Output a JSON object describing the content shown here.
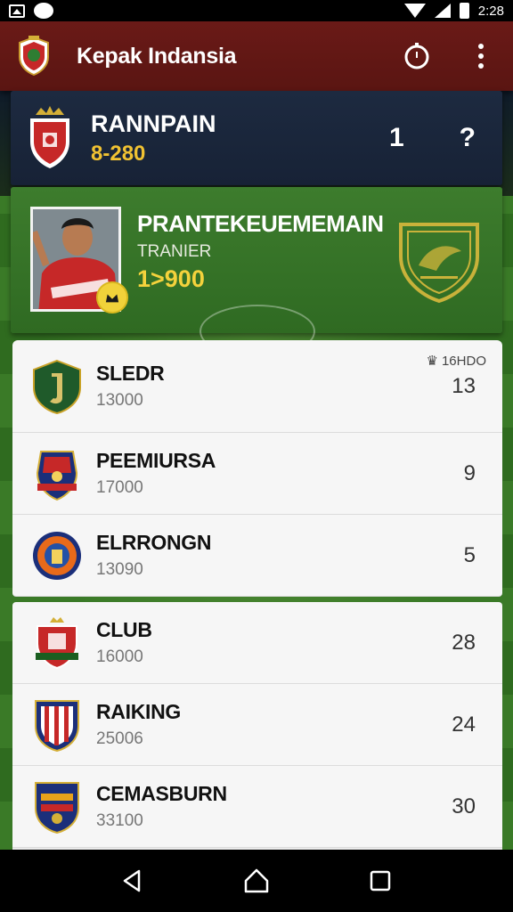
{
  "status_bar": {
    "time": "2:28",
    "icons": [
      "image-icon",
      "messenger-icon",
      "wifi-icon",
      "signal-icon",
      "battery-icon"
    ]
  },
  "app_bar": {
    "title": "Kepak Indansia",
    "icons": [
      "club-logo-icon",
      "timer-icon",
      "more-vert-icon"
    ],
    "bg_color": "#6a1a17"
  },
  "ranking_card": {
    "title": "RANNPAIN",
    "subtitle": "8-280",
    "rank": "1",
    "help": "?"
  },
  "featured_player": {
    "name": "PRANTEKEUEMEMAIN",
    "role": "TRANIER",
    "value": "1>900"
  },
  "list": {
    "badge": "16HDO",
    "teams": [
      {
        "name": "SLEDR",
        "points": "13000",
        "rank": "13"
      },
      {
        "name": "PEEMIURSA",
        "points": "17000",
        "rank": "9"
      },
      {
        "name": "ELRRONGN",
        "points": "13090",
        "rank": "5"
      },
      {
        "name": "CLUB",
        "points": "16000",
        "rank": "28"
      },
      {
        "name": "RAIKING",
        "points": "25006",
        "rank": "24"
      },
      {
        "name": "CEMASBURN",
        "points": "33100",
        "rank": "30"
      }
    ]
  },
  "nav_bar": {
    "icons": [
      "back-icon",
      "home-icon",
      "recents-icon"
    ]
  },
  "colors": {
    "accent_gold": "#f1c232",
    "app_bar_red": "#6a1a17",
    "pitch_green": "#3d7c2d",
    "card_navy": "#1d2a40"
  }
}
